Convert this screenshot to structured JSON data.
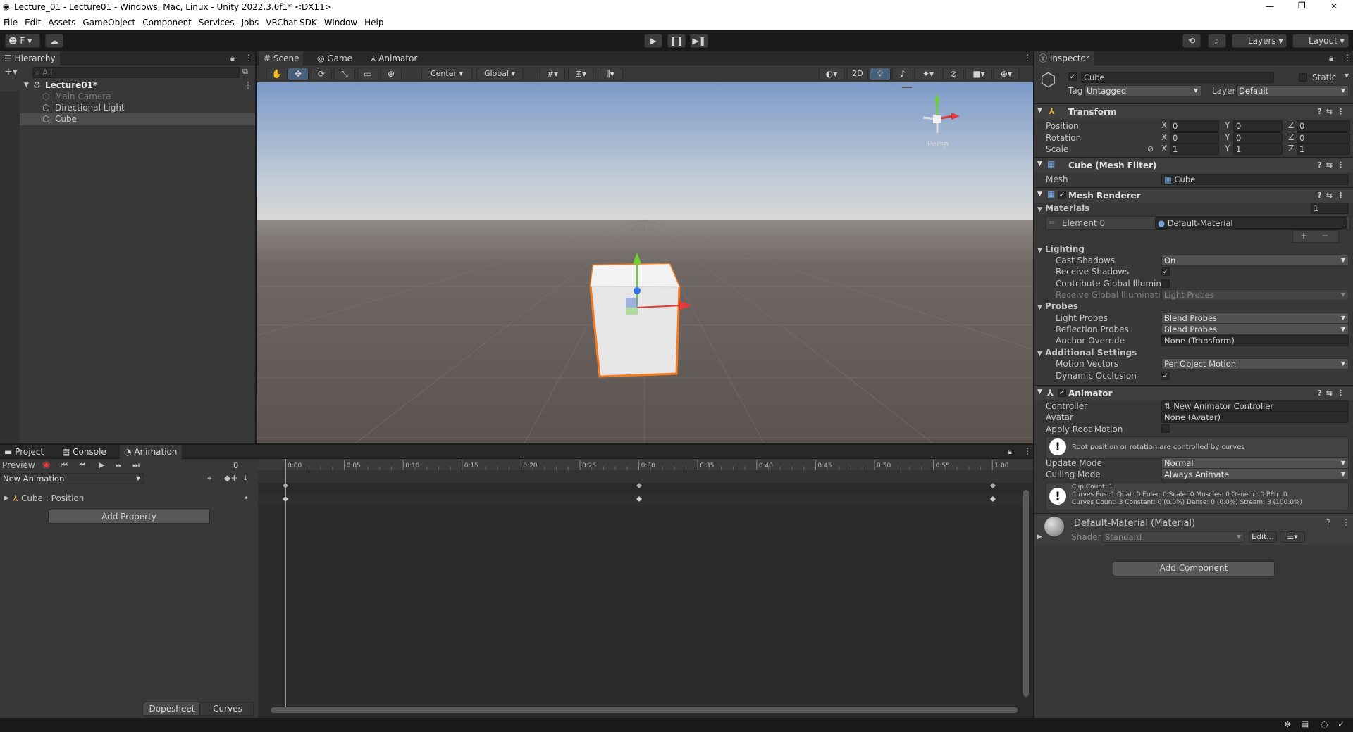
{
  "window": {
    "title": "Lecture_01 - Lecture01 - Windows, Mac, Linux - Unity 2022.3.6f1* <DX11>",
    "controls": [
      "—",
      "❐",
      "✕"
    ]
  },
  "menu": [
    "File",
    "Edit",
    "Assets",
    "GameObject",
    "Component",
    "Services",
    "Jobs",
    "VRChat SDK",
    "Window",
    "Help"
  ],
  "toolbar": {
    "account_label": "F",
    "layers": "Layers",
    "layout": "Layout"
  },
  "hierarchy": {
    "tab": "Hierarchy",
    "search_placeholder": "All",
    "scene": "Lecture01*",
    "items": [
      "Main Camera",
      "Directional Light",
      "Cube"
    ]
  },
  "scene_tabs": [
    "Scene",
    "Game",
    "Animator"
  ],
  "scene_toolbar": {
    "pivot": "Center",
    "space": "Global",
    "mode_2d": "2D",
    "persp": "Persp"
  },
  "bottom_tabs": [
    "Project",
    "Console",
    "Animation"
  ],
  "animation": {
    "preview": "Preview",
    "frame": "0",
    "clip": "New Animation",
    "property": "Cube : Position",
    "add_property": "Add Property",
    "dopesheet": "Dopesheet",
    "curves": "Curves",
    "ticks": [
      "0:00",
      "0:05",
      "0:10",
      "0:15",
      "0:20",
      "0:25",
      "0:30",
      "0:35",
      "0:40",
      "0:45",
      "0:50",
      "0:55",
      "1:00"
    ]
  },
  "inspector": {
    "tab": "Inspector",
    "object_name": "Cube",
    "static": "Static",
    "tag_label": "Tag",
    "tag": "Untagged",
    "layer_label": "Layer",
    "layer": "Default",
    "transform": {
      "title": "Transform",
      "position": "Position",
      "rotation": "Rotation",
      "scale": "Scale",
      "pos": [
        "0",
        "0",
        "0"
      ],
      "rot": [
        "0",
        "0",
        "0"
      ],
      "scl": [
        "1",
        "1",
        "1"
      ]
    },
    "mesh_filter": {
      "title": "Cube (Mesh Filter)",
      "mesh_label": "Mesh",
      "mesh": "Cube"
    },
    "mesh_renderer": {
      "title": "Mesh Renderer",
      "materials": "Materials",
      "materials_count": "1",
      "element0": "Element 0",
      "material": "Default-Material",
      "lighting": "Lighting",
      "cast_shadows": "Cast Shadows",
      "cast_shadows_val": "On",
      "receive_shadows": "Receive Shadows",
      "contribute_gi": "Contribute Global Illuminat",
      "receive_gi": "Receive Global Illuminatior",
      "receive_gi_val": "Light Probes",
      "probes": "Probes",
      "light_probes": "Light Probes",
      "light_probes_val": "Blend Probes",
      "reflection_probes": "Reflection Probes",
      "reflection_probes_val": "Blend Probes",
      "anchor_override": "Anchor Override",
      "anchor_override_val": "None (Transform)",
      "additional": "Additional Settings",
      "motion_vectors": "Motion Vectors",
      "motion_vectors_val": "Per Object Motion",
      "dynamic_occlusion": "Dynamic Occlusion"
    },
    "animator": {
      "title": "Animator",
      "controller": "Controller",
      "controller_val": "New Animator Controller",
      "avatar": "Avatar",
      "avatar_val": "None (Avatar)",
      "apply_root_motion": "Apply Root Motion",
      "info": "Root position or rotation are controlled by curves",
      "update_mode": "Update Mode",
      "update_mode_val": "Normal",
      "culling_mode": "Culling Mode",
      "culling_mode_val": "Always Animate",
      "clip_info": [
        "Clip Count: 1",
        "Curves Pos: 1 Quat: 0 Euler: 0 Scale: 0 Muscles: 0 Generic: 0 PPtr: 0",
        "Curves Count: 3 Constant: 0 (0.0%) Dense: 0 (0.0%) Stream: 3 (100.0%)"
      ]
    },
    "material": {
      "title": "Default-Material (Material)",
      "shader_label": "Shader",
      "shader": "Standard",
      "edit": "Edit..."
    },
    "add_component": "Add Component"
  }
}
